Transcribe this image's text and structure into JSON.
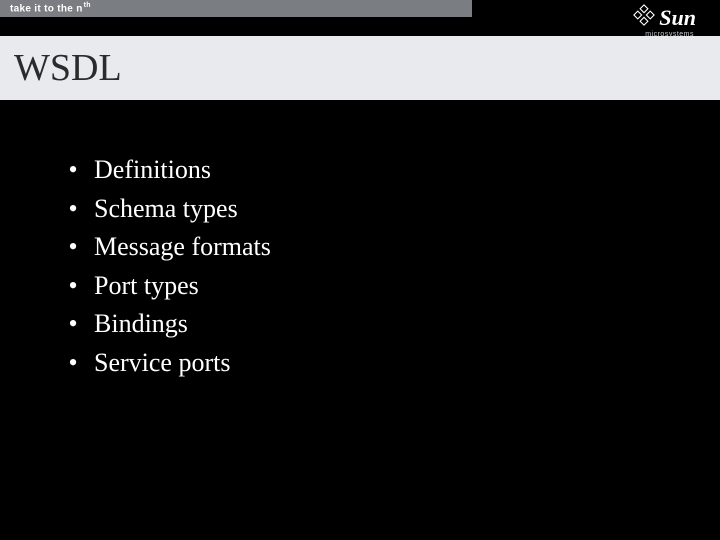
{
  "header": {
    "tagline_pre": "take it to the ",
    "tagline_n": "n",
    "tagline_sup": "th",
    "logo_text": "Sun",
    "logo_sub": "microsystems"
  },
  "title": "WSDL",
  "bullets": [
    "Definitions",
    "Schema types",
    "Message formats",
    "Port types",
    "Bindings",
    "Service ports"
  ]
}
